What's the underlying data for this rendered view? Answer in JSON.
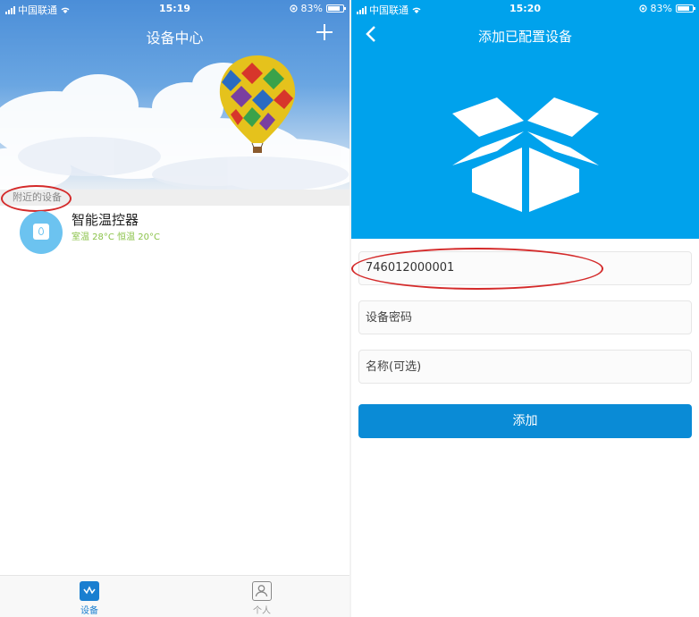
{
  "left": {
    "status": {
      "carrier": "中国联通",
      "time": "15:19",
      "battery": "83%",
      "battery_level": 0.83
    },
    "header": {
      "title": "设备中心"
    },
    "section": {
      "nearby_label": "附近的设备"
    },
    "devices": [
      {
        "name": "智能温控器",
        "status": "室温 28°C 恒温 20°C"
      }
    ],
    "tabs": [
      {
        "label": "设备",
        "active": true
      },
      {
        "label": "个人",
        "active": false
      }
    ]
  },
  "right": {
    "status": {
      "carrier": "中国联通",
      "time": "15:20",
      "battery": "83%",
      "battery_level": 0.83
    },
    "header": {
      "title": "添加已配置设备"
    },
    "form": {
      "device_id_value": "746012000001",
      "password_placeholder": "设备密码",
      "name_placeholder": "名称(可选)",
      "submit_label": "添加"
    }
  },
  "colors": {
    "accent_blue": "#00a2ec",
    "button_blue": "#0a8bd6",
    "annotation_red": "#d42a2a",
    "status_green": "#8bc34a"
  }
}
